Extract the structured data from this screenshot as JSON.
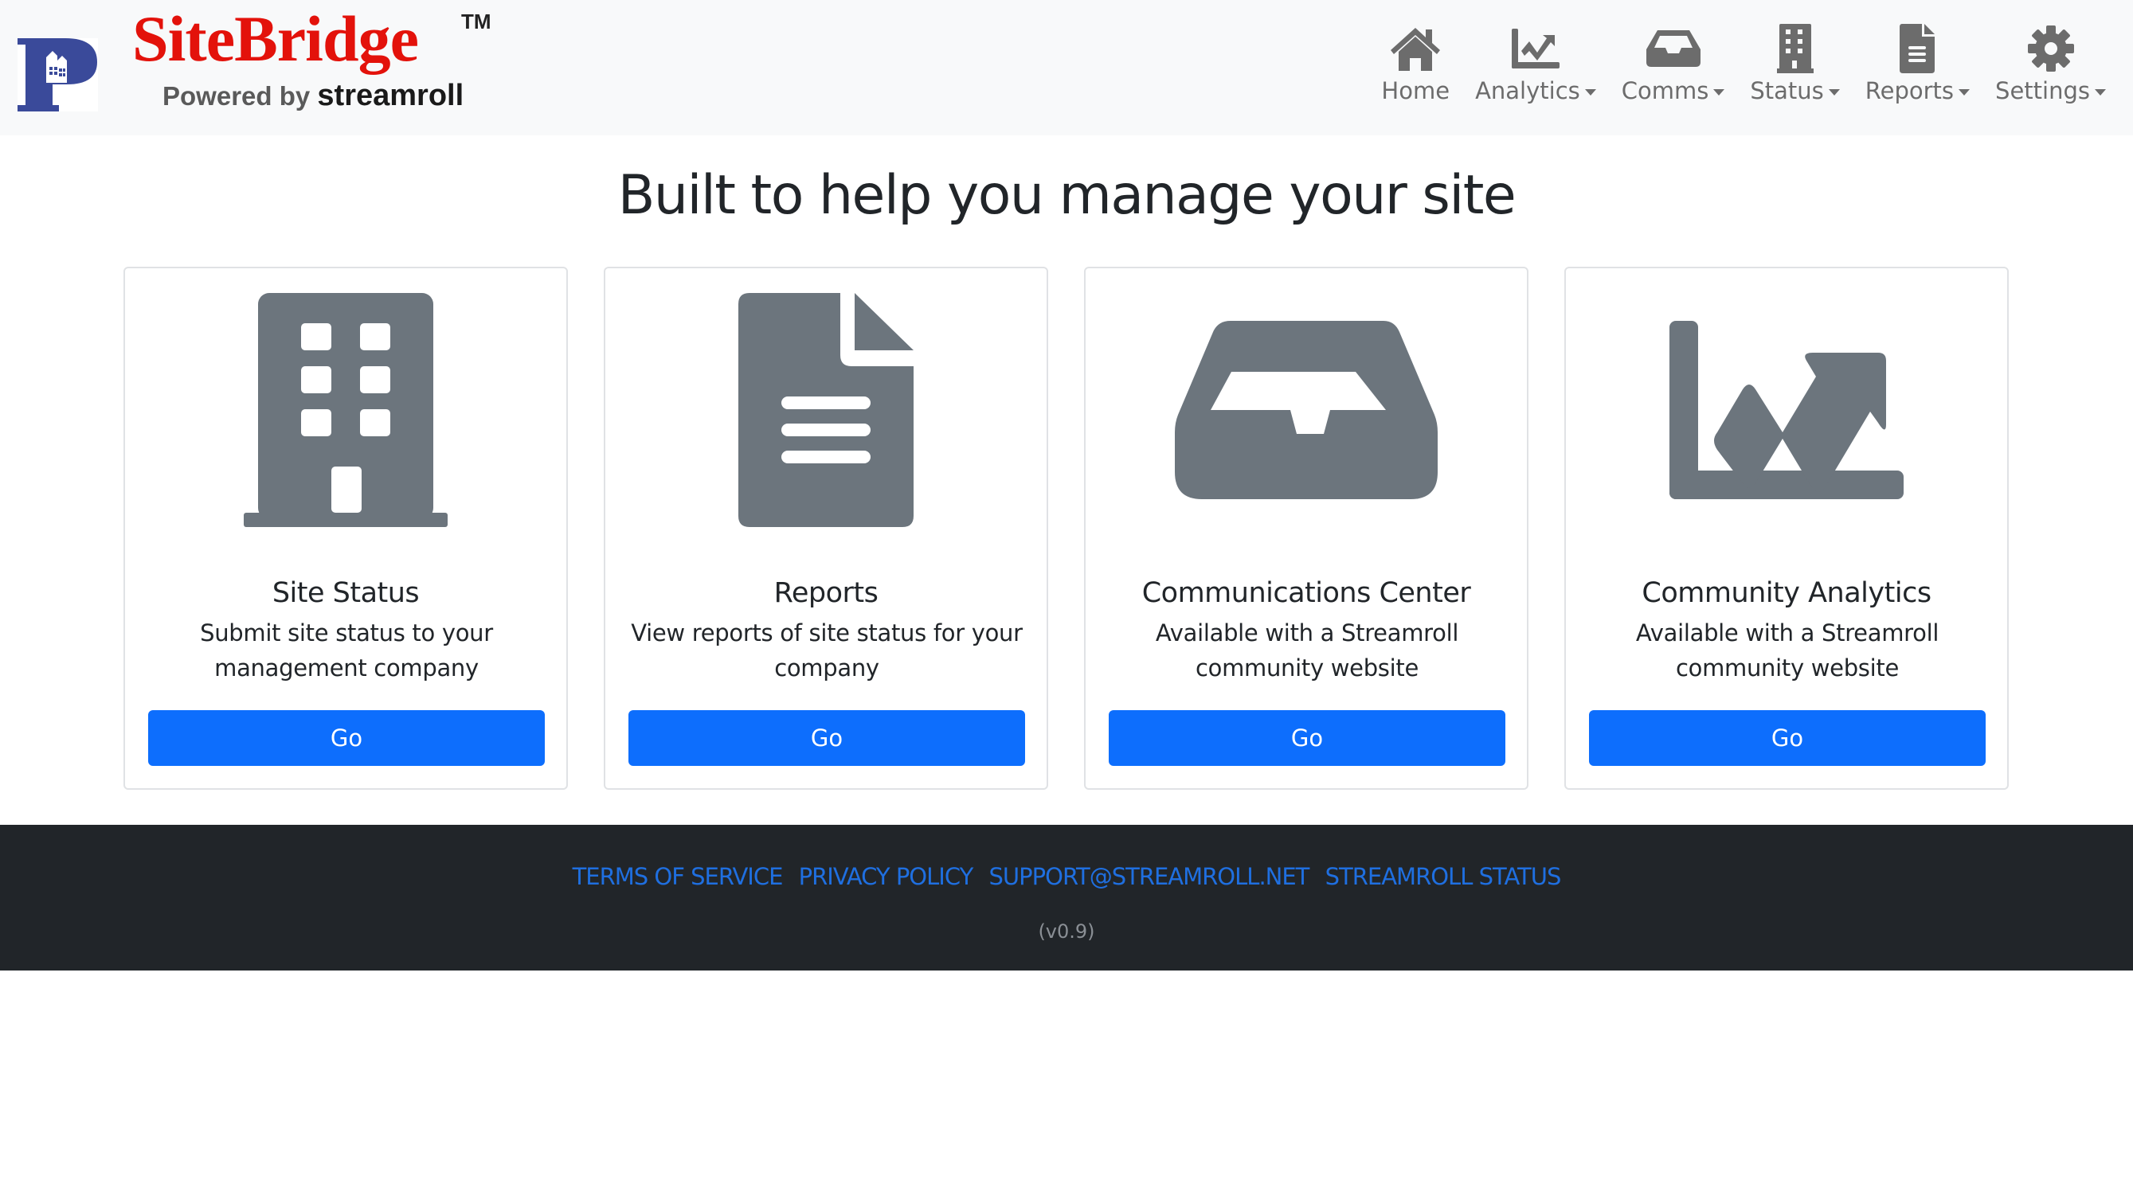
{
  "header": {
    "brand_name": "SiteBridge",
    "brand_tm": "TM",
    "powered_by": "Powered by",
    "powered_by_brand": "streamroll",
    "nav": [
      {
        "label": "Home",
        "icon": "home-icon",
        "dropdown": false
      },
      {
        "label": "Analytics",
        "icon": "chart-line-icon",
        "dropdown": true
      },
      {
        "label": "Comms",
        "icon": "inbox-icon",
        "dropdown": true
      },
      {
        "label": "Status",
        "icon": "building-icon",
        "dropdown": true
      },
      {
        "label": "Reports",
        "icon": "file-icon",
        "dropdown": true
      },
      {
        "label": "Settings",
        "icon": "gear-icon",
        "dropdown": true
      }
    ]
  },
  "main": {
    "title": "Built to help you manage your site",
    "cards": [
      {
        "icon": "building-icon",
        "title": "Site Status",
        "description": "Submit site status to your management company",
        "button": "Go"
      },
      {
        "icon": "file-icon",
        "title": "Reports",
        "description": "View reports of site status for your company",
        "button": "Go"
      },
      {
        "icon": "inbox-icon",
        "title": "Communications Center",
        "description": "Available with a Streamroll community website",
        "button": "Go"
      },
      {
        "icon": "chart-line-icon",
        "title": "Community Analytics",
        "description": "Available with a Streamroll community website",
        "button": "Go"
      }
    ]
  },
  "footer": {
    "links": [
      "TERMS OF SERVICE",
      "PRIVACY POLICY",
      "SUPPORT@STREAMROLL.NET",
      "STREAMROLL STATUS"
    ],
    "version": "(v0.9)"
  },
  "colors": {
    "primary": "#0d6efd",
    "brand_red": "#e3120b",
    "icon_gray": "#6c757d",
    "footer_bg": "#212529",
    "footer_link": "#1f6fe0"
  }
}
